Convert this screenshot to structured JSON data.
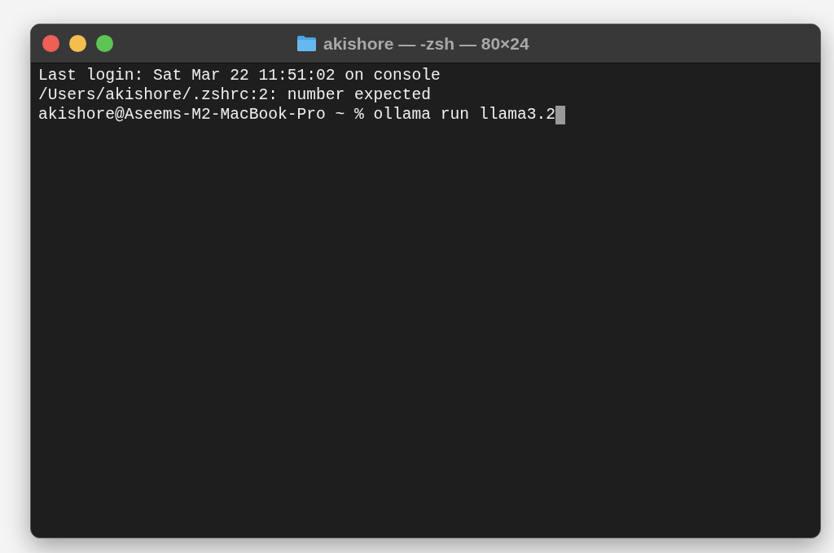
{
  "window": {
    "title": "akishore — -zsh — 80×24"
  },
  "terminal": {
    "lines": [
      "Last login: Sat Mar 22 11:51:02 on console",
      "/Users/akishore/.zshrc:2: number expected",
      "akishore@Aseems-M2-MacBook-Pro ~ % ollama run llama3.2"
    ],
    "cursor": true
  }
}
